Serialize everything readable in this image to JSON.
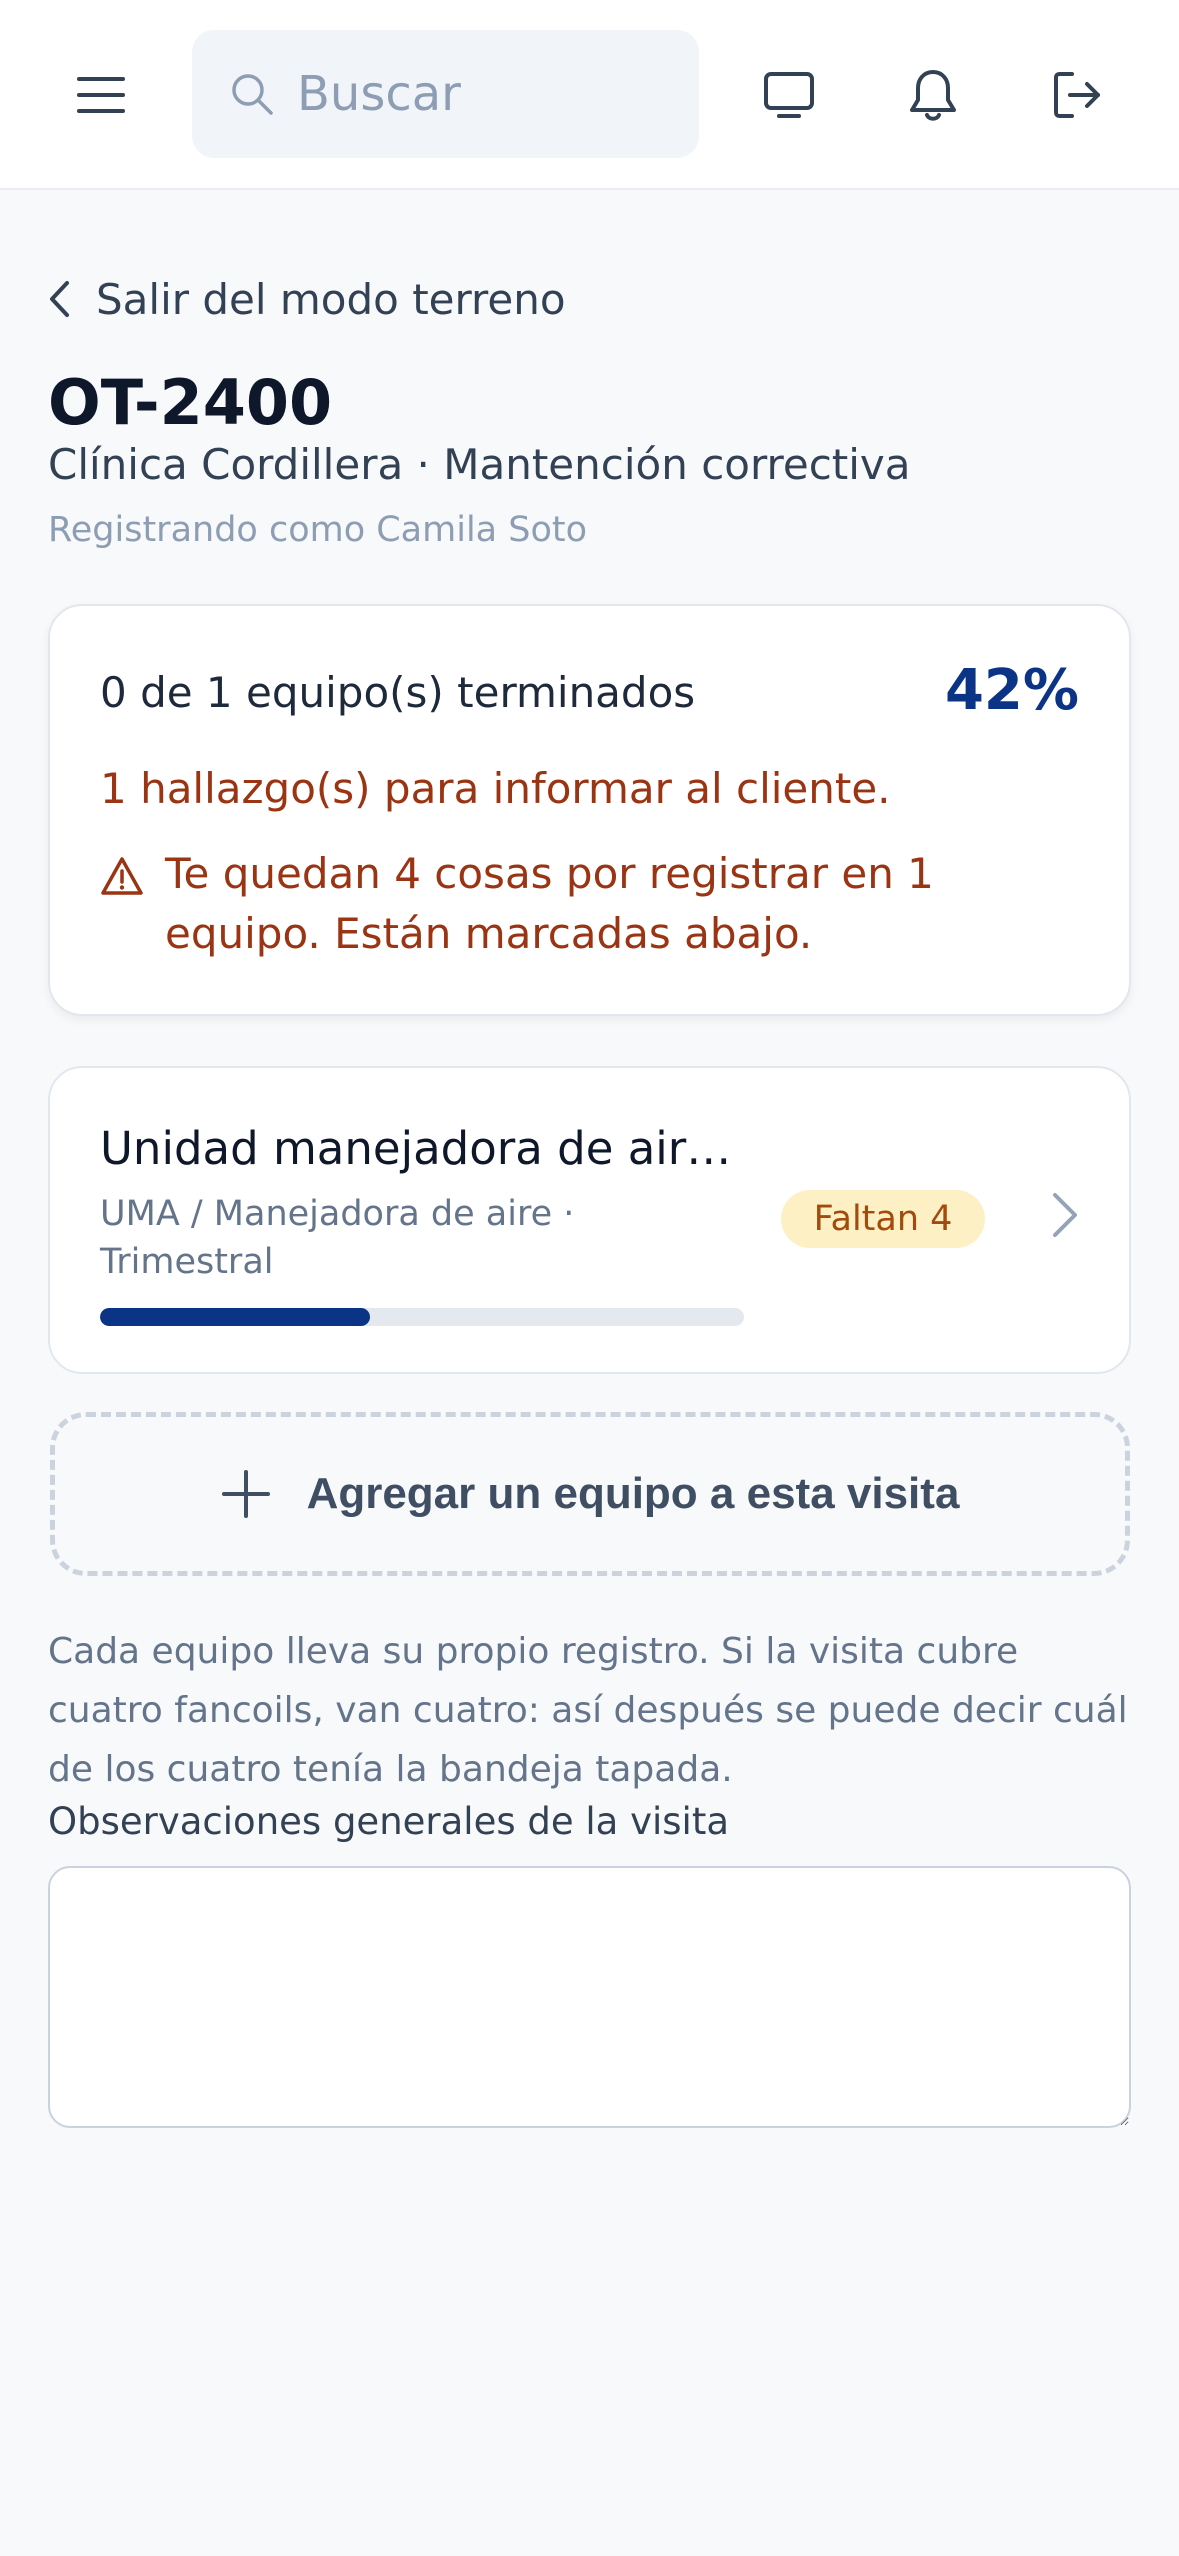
{
  "search": {
    "placeholder": "Buscar"
  },
  "back": {
    "label": "Salir del modo terreno"
  },
  "order": {
    "code": "OT-2400",
    "subtitle": "Clínica Cordillera · Mantención correctiva",
    "recorder": "Registrando como Camila Soto"
  },
  "summary": {
    "done_text": "0 de 1 equipo(s) terminados",
    "percent": "42%",
    "findings_text": "1 hallazgo(s) para informar al cliente.",
    "warning_text": "Te quedan 4 cosas por registrar en 1 equipo. Están marcadas abajo."
  },
  "equipment": [
    {
      "name": "Unidad manejadora de air…",
      "meta": "UMA / Manejadora de aire · Trimestral",
      "badge": "Faltan 4",
      "progress": 0.42
    }
  ],
  "add_equipment": {
    "label": "Agregar un equipo a esta visita"
  },
  "hint": "Cada equipo lleva su propio registro. Si la visita cubre cuatro fancoils, van cuatro: así después se puede decir cuál de los cuatro tenía la bandeja tapada.",
  "observations": {
    "label": "Observaciones generales de la visita",
    "value": ""
  },
  "icons": {
    "menu": "menu-icon",
    "search": "search-icon",
    "monitor": "monitor-icon",
    "bell": "bell-icon",
    "logout": "logout-icon",
    "back": "chevron-left-icon",
    "warning": "warning-icon",
    "chevron": "chevron-right-icon",
    "plus": "plus-icon"
  },
  "colors": {
    "accent": "#0b3486",
    "warning_text": "#9a3412",
    "badge_bg": "#fdf0c4",
    "badge_text": "#a24b0c"
  }
}
